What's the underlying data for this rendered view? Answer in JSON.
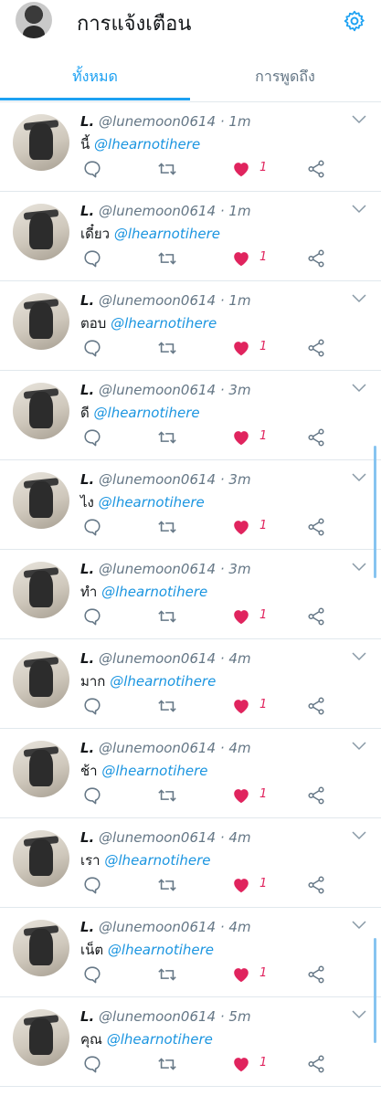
{
  "header": {
    "title": "การแจ้งเตือน",
    "avatar_icon": "profile-avatar",
    "settings_icon": "gear-icon"
  },
  "tabs": [
    {
      "label": "ทั้งหมด",
      "active": true
    },
    {
      "label": "การพูดถึง",
      "active": false
    }
  ],
  "colors": {
    "accent": "#1da1f2",
    "like": "#e0245e",
    "muted": "#657786"
  },
  "notifications": [
    {
      "name": "L.",
      "handle": "@lunemoon0614",
      "time": "· 1m",
      "word": "นี้",
      "mention": "@lhearnotihere",
      "likes": "1"
    },
    {
      "name": "L.",
      "handle": "@lunemoon0614",
      "time": "· 1m",
      "word": "เดี๋ยว",
      "mention": "@lhearnotihere",
      "likes": "1"
    },
    {
      "name": "L.",
      "handle": "@lunemoon0614",
      "time": "· 1m",
      "word": "ตอบ",
      "mention": "@lhearnotihere",
      "likes": "1"
    },
    {
      "name": "L.",
      "handle": "@lunemoon0614",
      "time": "· 3m",
      "word": "ดี",
      "mention": "@lhearnotihere",
      "likes": "1"
    },
    {
      "name": "L.",
      "handle": "@lunemoon0614",
      "time": "· 3m",
      "word": "ไง",
      "mention": "@lhearnotihere",
      "likes": "1"
    },
    {
      "name": "L.",
      "handle": "@lunemoon0614",
      "time": "· 3m",
      "word": "ทำ",
      "mention": "@lhearnotihere",
      "likes": "1"
    },
    {
      "name": "L.",
      "handle": "@lunemoon0614",
      "time": "· 4m",
      "word": "มาก",
      "mention": "@lhearnotihere",
      "likes": "1"
    },
    {
      "name": "L.",
      "handle": "@lunemoon0614",
      "time": "· 4m",
      "word": "ช้า",
      "mention": "@lhearnotihere",
      "likes": "1"
    },
    {
      "name": "L.",
      "handle": "@lunemoon0614",
      "time": "· 4m",
      "word": "เรา",
      "mention": "@lhearnotihere",
      "likes": "1"
    },
    {
      "name": "L.",
      "handle": "@lunemoon0614",
      "time": "· 4m",
      "word": "เน็ต",
      "mention": "@lhearnotihere",
      "likes": "1"
    },
    {
      "name": "L.",
      "handle": "@lunemoon0614",
      "time": "· 5m",
      "word": "คุณ",
      "mention": "@lhearnotihere",
      "likes": "1"
    }
  ]
}
